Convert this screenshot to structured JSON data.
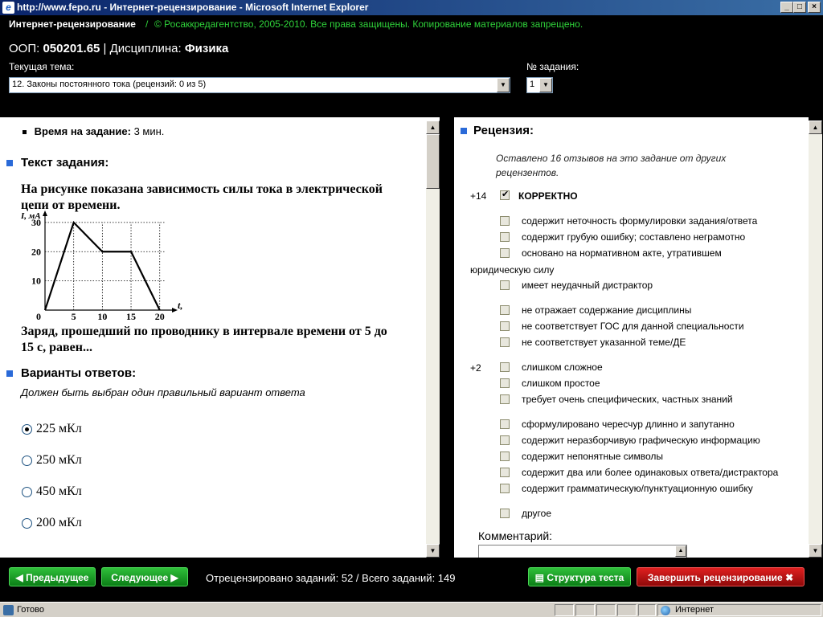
{
  "window": {
    "title": "http://www.fepo.ru - Интернет-рецензирование - Microsoft Internet Explorer"
  },
  "header": {
    "brand": "Интернет-рецензирование",
    "separator": "/",
    "copyright": "© Росаккредагентство, 2005-2010. Все права защищены. Копирование материалов запрещено.",
    "oop_label": "ООП:",
    "oop_value": "050201.65",
    "discipline_label": "| Дисциплина:",
    "discipline_value": "Физика",
    "topic_label": "Текущая тема:",
    "topic_value": "12. Законы постоянного тока  (рецензий: 0 из 5)",
    "task_number_label": "№ задания:",
    "task_number_value": "1"
  },
  "task": {
    "time_label": "Время на задание:",
    "time_value": "3 мин.",
    "text_heading": "Текст задания:",
    "question_line1": "На рисунке показана зависимость силы тока в электрической",
    "question_line2": "цепи от времени.",
    "question_after_line1": "Заряд, прошедший по проводнику в интервале времени от 5 до",
    "question_after_line2": "15 с, равен...",
    "answers_heading": "Варианты ответов:",
    "answers_hint": "Должен быть выбран один правильный вариант ответа",
    "answers": [
      {
        "label": "225 мКл",
        "selected": true
      },
      {
        "label": "250 мКл",
        "selected": false
      },
      {
        "label": "450 мКл",
        "selected": false
      },
      {
        "label": "200 мКл",
        "selected": false
      }
    ]
  },
  "chart_data": {
    "type": "line",
    "x": [
      0,
      5,
      10,
      15,
      20
    ],
    "y": [
      0,
      30,
      20,
      20,
      0
    ],
    "xticks": [
      "0",
      "5",
      "10",
      "15",
      "20"
    ],
    "yticks": [
      "10",
      "20",
      "30"
    ],
    "xlabel": "t, с",
    "ylabel": "I, мА",
    "xlim": [
      0,
      22
    ],
    "ylim": [
      0,
      33
    ],
    "grid": true
  },
  "review": {
    "heading": "Рецензия:",
    "note_line1": "Оставлено 16 отзывов на это задание от других",
    "note_line2": "рецензентов.",
    "correct_score": "+14",
    "correct_label": "КОРРЕКТНО",
    "correct_checked": true,
    "criteria_a": [
      "содержит неточность формулировки задания/ответа",
      "содержит грубую ошибку; составлено неграмотно",
      "основано на нормативном акте, утратившем",
      "имеет неудачный дистрактор"
    ],
    "criteria_a_wrap": "юридическую силу",
    "criteria_b": [
      "не отражает содержание дисциплины",
      "не соответствует ГОС для данной специальности",
      "не соответствует указанной теме/ДЕ"
    ],
    "criteria_c_score": "+2",
    "criteria_c": [
      "слишком сложное",
      "слишком простое",
      "требует очень специфических, частных знаний"
    ],
    "criteria_d": [
      "сформулировано чересчур длинно и запутанно",
      "содержит неразборчивую графическую информацию",
      "содержит непонятные символы",
      "содержит два или более одинаковых ответа/дистрактора",
      "содержит грамматическую/пунктуационную ошибку"
    ],
    "other_label": "другое",
    "comment_label": "Комментарий:"
  },
  "footer": {
    "prev_label": "Предыдущее",
    "next_label": "Следующее",
    "status_text": "Отрецензировано заданий: 52 / Всего заданий: 149",
    "structure_label": "Структура теста",
    "finish_label": "Завершить рецензирование"
  },
  "statusbar": {
    "left_text": "Готово",
    "zone_text": "Интернет"
  }
}
